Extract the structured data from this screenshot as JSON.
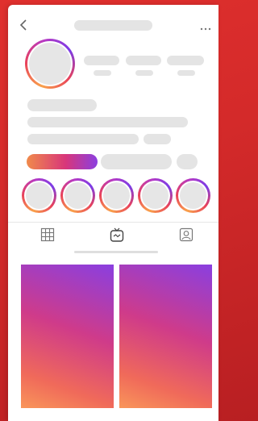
{
  "header": {
    "back_icon": "chevron-left-icon",
    "more_icon": "more-horizontal-icon"
  },
  "profile": {
    "avatar": "avatar-placeholder",
    "stats": [
      "post-count-placeholder",
      "follower-count-placeholder",
      "following-count-placeholder"
    ]
  },
  "actions": {
    "follow_button_gradient": [
      "#f08a4b",
      "#d8367a",
      "#8b3fe0"
    ]
  },
  "highlights": {
    "count": 5
  },
  "tabs": [
    {
      "icon": "grid-icon",
      "active": false
    },
    {
      "icon": "igtv-icon",
      "active": true
    },
    {
      "icon": "tagged-icon",
      "active": false
    }
  ],
  "colors": {
    "background": "#d42a2a",
    "placeholder": "#e4e4e4",
    "story_ring": [
      "#f9a24b",
      "#e8415a",
      "#b83ac2",
      "#7b3ce6"
    ],
    "tile_gradient": [
      "#8a3fe0",
      "#cf3b8a",
      "#f06a5a",
      "#f9965a"
    ]
  },
  "grid": {
    "tile_count": 2
  }
}
